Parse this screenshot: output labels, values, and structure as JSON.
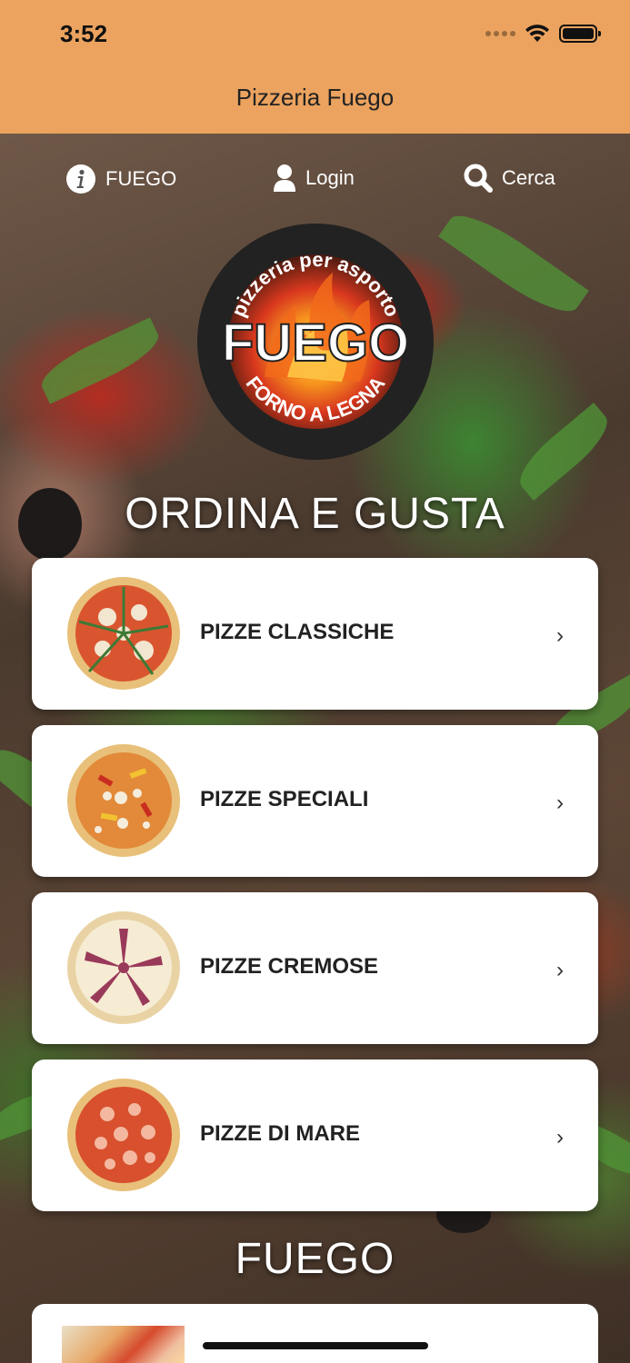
{
  "status_bar": {
    "time": "3:52"
  },
  "header": {
    "title": "Pizzeria Fuego"
  },
  "nav": {
    "info_label": "FUEGO",
    "login_label": "Login",
    "search_label": "Cerca"
  },
  "logo": {
    "top_text": "pizzeria per asporto",
    "main_text": "FUEGO",
    "bottom_text": "FORNO A LEGNA"
  },
  "sections": {
    "order_title": "ORDINA E GUSTA",
    "fuego_title": "FUEGO"
  },
  "categories": [
    {
      "label": "PIZZE CLASSICHE",
      "chevron": "›"
    },
    {
      "label": "PIZZE SPECIALI",
      "chevron": "›"
    },
    {
      "label": "PIZZE CREMOSE",
      "chevron": "›"
    },
    {
      "label": "PIZZE DI MARE",
      "chevron": "›"
    }
  ],
  "colors": {
    "header_bg": "#eba35f",
    "card_bg": "#ffffff",
    "text_dark": "#222222"
  },
  "icons": [
    "info-icon",
    "user-icon",
    "search-icon",
    "wifi-icon",
    "battery-icon",
    "chevron-right-icon"
  ]
}
